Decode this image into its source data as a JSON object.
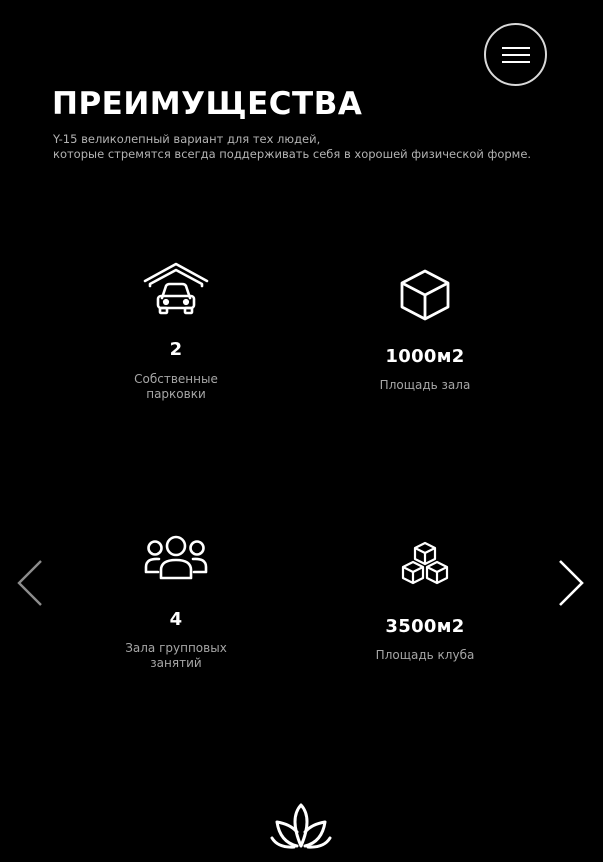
{
  "header": {
    "menu_icon": "hamburger-icon",
    "title": "ПРЕИМУЩЕСТВА",
    "subtitle_lines": [
      "Y-15 великолепный вариант для тех людей,",
      "которые стремятся всегда поддерживать себя в хорошей физической форме."
    ]
  },
  "features": [
    {
      "icon": "garage-car-icon",
      "value": "2",
      "label_lines": [
        "Собственные",
        "парковки"
      ]
    },
    {
      "icon": "cube-icon",
      "value": "1000м2",
      "label_lines": [
        "Площадь зала"
      ]
    },
    {
      "icon": "group-icon",
      "value": "4",
      "label_lines": [
        "Зала групповых",
        "занятий"
      ]
    },
    {
      "icon": "cubes-icon",
      "value": "3500м2",
      "label_lines": [
        "Площадь клуба"
      ]
    }
  ],
  "carousel": {
    "prev_icon": "chevron-left-icon",
    "next_icon": "chevron-right-icon"
  },
  "footer": {
    "logo_icon": "lotus-icon"
  },
  "colors": {
    "background": "#000000",
    "text": "#ffffff",
    "muted_text": "#a6a6a6"
  }
}
